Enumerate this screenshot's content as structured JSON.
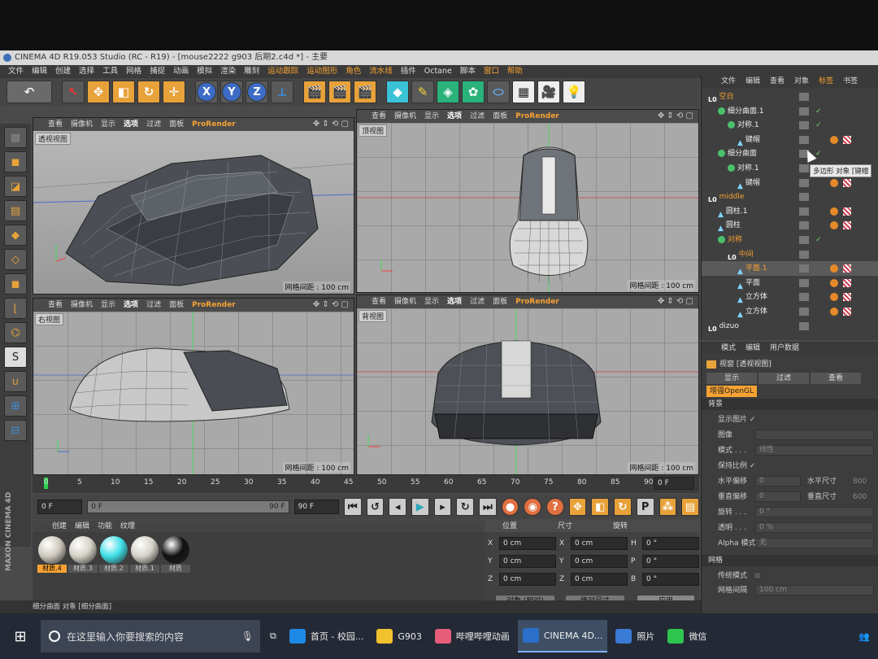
{
  "window": {
    "title": "CINEMA 4D R19.053 Studio (RC - R19) - [mouse2222 g903 后期2.c4d *] - 主要"
  },
  "menu": [
    "文件",
    "编辑",
    "创建",
    "选择",
    "工具",
    "网格",
    "捕捉",
    "动画",
    "模拟",
    "渲染",
    "雕刻",
    "运动跟踪",
    "运动图形",
    "角色",
    "流水线",
    "插件",
    "Octane",
    "脚本",
    "窗口",
    "帮助"
  ],
  "menu_highlight": [
    "运动跟踪",
    "运动图形",
    "角色",
    "流水线",
    "窗口",
    "帮助"
  ],
  "viewport_menu": [
    "查看",
    "摄像机",
    "显示",
    "选项",
    "过滤",
    "面板",
    "ProRender"
  ],
  "viewports": [
    {
      "label": "透视视图",
      "grid": ""
    },
    {
      "label": "顶视图",
      "grid": "网格间距 : 100 cm"
    },
    {
      "label": "右视图",
      "grid": "网格间距 : 100 cm"
    },
    {
      "label": "背视图",
      "grid": "网格间距 : 100 cm"
    }
  ],
  "persp_grid": "网格间距 : 100 cm",
  "timeline": {
    "ticks": [
      "0",
      "5",
      "10",
      "15",
      "20",
      "25",
      "30",
      "35",
      "40",
      "45",
      "50",
      "55",
      "60",
      "65",
      "70",
      "75",
      "80",
      "85",
      "90"
    ],
    "current_frame": "0 F",
    "start": "0 F",
    "slider_left": "0 F",
    "slider_right": "90 F",
    "end": "90 F"
  },
  "materials": {
    "tabs": [
      "创建",
      "编辑",
      "功能",
      "纹理"
    ],
    "items": [
      "材质.4",
      "材质.3",
      "材质.2",
      "材质.1",
      "材质"
    ],
    "colors": [
      "#cfcac0",
      "#d6d2c8",
      "#3fe0e8",
      "#d7d3cb",
      "#111111"
    ]
  },
  "coords": {
    "headers": [
      "位置",
      "尺寸",
      "旋转"
    ],
    "pos": [
      "0 cm",
      "0 cm",
      "0 cm"
    ],
    "size": [
      "0 cm",
      "0 cm",
      "0 cm"
    ],
    "rot": [
      "0 °",
      "0 °",
      "0 °"
    ],
    "axes": [
      "X",
      "Y",
      "Z"
    ],
    "rot_axes": [
      "H",
      "P",
      "B"
    ],
    "mode_btn": "对象 (相对)",
    "size_btn": "绝对尺寸",
    "apply_btn": "应用"
  },
  "object_manager": {
    "tabs": [
      "文件",
      "编辑",
      "查看",
      "对象",
      "标签",
      "书签"
    ],
    "rows": [
      {
        "name": "空白",
        "indent": 0,
        "type": "null",
        "orange": true
      },
      {
        "name": "细分曲面.1",
        "indent": 1,
        "type": "sds",
        "orange": false
      },
      {
        "name": "对称.1",
        "indent": 2,
        "type": "sym",
        "orange": false
      },
      {
        "name": "键帽",
        "indent": 3,
        "type": "poly",
        "orange": false
      },
      {
        "name": "细分曲面",
        "indent": 1,
        "type": "sds",
        "orange": false
      },
      {
        "name": "对称.1",
        "indent": 2,
        "type": "sym",
        "orange": false
      },
      {
        "name": "键帽",
        "indent": 3,
        "type": "poly",
        "orange": false
      },
      {
        "name": "middle",
        "indent": 0,
        "type": "null",
        "orange": true
      },
      {
        "name": "圆柱.1",
        "indent": 1,
        "type": "poly",
        "orange": false
      },
      {
        "name": "圆柱",
        "indent": 1,
        "type": "poly",
        "orange": false
      },
      {
        "name": "对称",
        "indent": 1,
        "type": "sym",
        "orange": true
      },
      {
        "name": "中间",
        "indent": 2,
        "type": "null",
        "orange": true
      },
      {
        "name": "平面.1",
        "indent": 3,
        "type": "poly",
        "orange": true
      },
      {
        "name": "平面",
        "indent": 3,
        "type": "poly",
        "orange": false
      },
      {
        "name": "立方体",
        "indent": 3,
        "type": "poly",
        "orange": false
      },
      {
        "name": "立方体",
        "indent": 3,
        "type": "poly",
        "orange": false
      },
      {
        "name": "dizuo",
        "indent": 0,
        "type": "null",
        "orange": false
      }
    ],
    "tooltip": "多边形 对象 [键帽"
  },
  "attributes": {
    "tabs": [
      "模式",
      "编辑",
      "用户数据"
    ],
    "title": "视窗 [透视视图]",
    "subtabs": [
      "显示",
      "过滤",
      "查看"
    ],
    "opengl": "增强OpenGL",
    "section_bg": "背景",
    "rows": [
      {
        "label": "显示图片 ✓",
        "value": ""
      },
      {
        "label": "图像",
        "value": ""
      },
      {
        "label": "模式 . . .",
        "value": "线性"
      },
      {
        "label": "保持比例 ✓",
        "value": ""
      },
      {
        "label": "水平偏移",
        "value": "0"
      },
      {
        "label": "垂直偏移",
        "value": "0"
      },
      {
        "label": "旋转 . . .",
        "value": "0 °"
      },
      {
        "label": "透明 . . .",
        "value": "0 %"
      },
      {
        "label": "Alpha 模式",
        "value": "无"
      }
    ],
    "right_labels": [
      "水平尺寸",
      "垂直尺寸"
    ],
    "right_values": [
      "800",
      "600"
    ],
    "section_grid": "网格",
    "grid_rows": [
      {
        "label": "传统模式",
        "value": ""
      },
      {
        "label": "网格间隔",
        "value": "100 cm"
      }
    ]
  },
  "status": "细分曲面 对象 [细分曲面]",
  "brand": "MAXON CINEMA 4D",
  "taskbar": {
    "search": "在这里输入你要搜索的内容",
    "items": [
      "首页 - 校园...",
      "G903",
      "哔哩哔哩动画",
      "CINEMA 4D...",
      "照片",
      "微信"
    ]
  }
}
